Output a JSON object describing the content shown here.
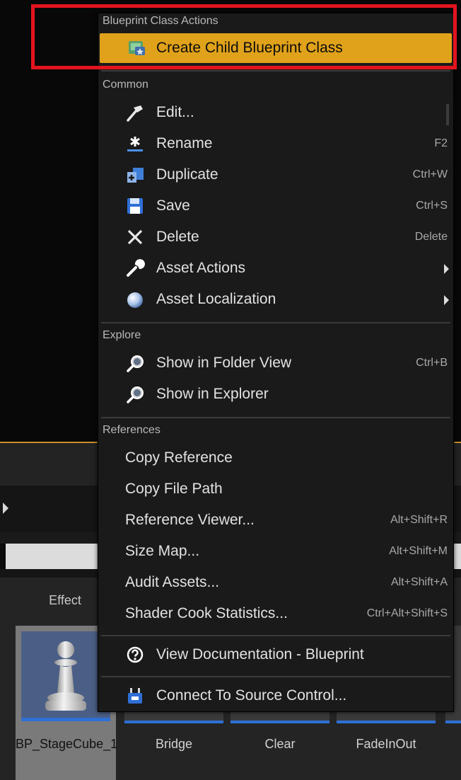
{
  "menu": {
    "sections": {
      "blueprint_class_actions": "Blueprint Class Actions",
      "common": "Common",
      "explore": "Explore",
      "references": "References"
    },
    "items": {
      "create_child": {
        "label": "Create Child Blueprint Class"
      },
      "edit": {
        "label": "Edit..."
      },
      "rename": {
        "label": "Rename",
        "shortcut": "F2"
      },
      "duplicate": {
        "label": "Duplicate",
        "shortcut": "Ctrl+W"
      },
      "save": {
        "label": "Save",
        "shortcut": "Ctrl+S"
      },
      "delete": {
        "label": "Delete",
        "shortcut": "Delete"
      },
      "asset_actions": {
        "label": "Asset Actions"
      },
      "asset_localization": {
        "label": "Asset Localization"
      },
      "show_folder_view": {
        "label": "Show in Folder View",
        "shortcut": "Ctrl+B"
      },
      "show_explorer": {
        "label": "Show in Explorer"
      },
      "copy_reference": {
        "label": "Copy Reference"
      },
      "copy_file_path": {
        "label": "Copy File Path"
      },
      "reference_viewer": {
        "label": "Reference Viewer...",
        "shortcut": "Alt+Shift+R"
      },
      "size_map": {
        "label": "Size Map...",
        "shortcut": "Alt+Shift+M"
      },
      "audit_assets": {
        "label": "Audit Assets...",
        "shortcut": "Alt+Shift+A"
      },
      "shader_cook": {
        "label": "Shader Cook Statistics...",
        "shortcut": "Ctrl+Alt+Shift+S"
      },
      "view_docs": {
        "label": "View Documentation - Blueprint"
      },
      "source_control": {
        "label": "Connect To Source Control..."
      }
    }
  },
  "content_browser": {
    "folder_label": "Effect",
    "assets": [
      {
        "name": "BP_StageCube_1"
      },
      {
        "name": "Bridge"
      },
      {
        "name": "Clear"
      },
      {
        "name": "FadeInOut"
      }
    ]
  },
  "colors": {
    "highlight": "#e0a21a",
    "annotation": "#e3141e",
    "menu_bg": "#1a1a1a",
    "asset_bar": "#2f6fd6"
  },
  "icons": {
    "create_child": "blueprint-class-icon",
    "edit": "hammer-icon",
    "rename": "asterisk-icon",
    "duplicate": "duplicate-icon",
    "save": "floppy-disk-icon",
    "delete": "x-icon",
    "asset_actions": "wrench-icon",
    "asset_localization": "globe-icon",
    "show_folder_view": "magnifier-icon",
    "show_explorer": "magnifier-icon",
    "view_docs": "help-icon",
    "source_control": "source-control-icon"
  }
}
